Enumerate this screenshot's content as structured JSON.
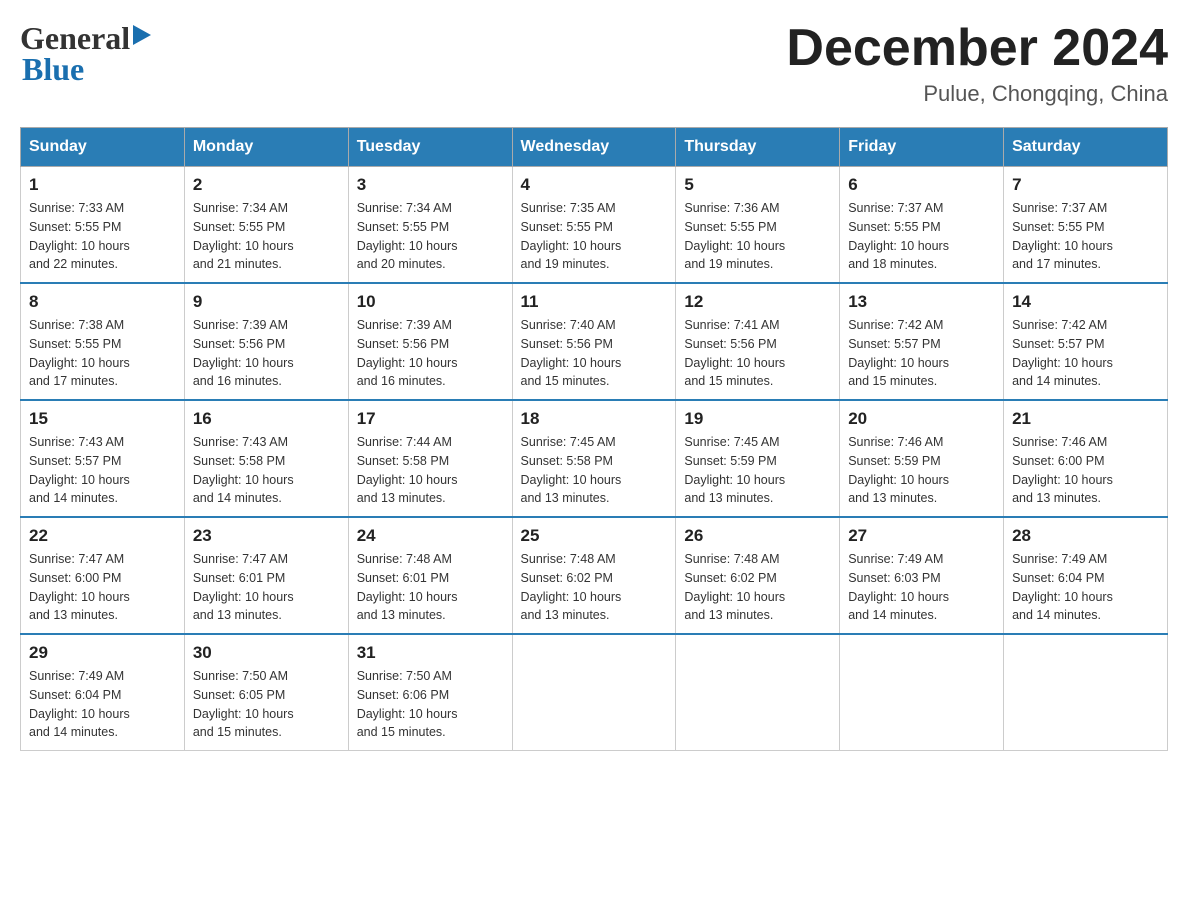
{
  "header": {
    "title": "December 2024",
    "subtitle": "Pulue, Chongqing, China",
    "logo_general": "General",
    "logo_blue": "Blue"
  },
  "days_of_week": [
    "Sunday",
    "Monday",
    "Tuesday",
    "Wednesday",
    "Thursday",
    "Friday",
    "Saturday"
  ],
  "weeks": [
    [
      {
        "day": "1",
        "sunrise": "7:33 AM",
        "sunset": "5:55 PM",
        "daylight": "10 hours and 22 minutes."
      },
      {
        "day": "2",
        "sunrise": "7:34 AM",
        "sunset": "5:55 PM",
        "daylight": "10 hours and 21 minutes."
      },
      {
        "day": "3",
        "sunrise": "7:34 AM",
        "sunset": "5:55 PM",
        "daylight": "10 hours and 20 minutes."
      },
      {
        "day": "4",
        "sunrise": "7:35 AM",
        "sunset": "5:55 PM",
        "daylight": "10 hours and 19 minutes."
      },
      {
        "day": "5",
        "sunrise": "7:36 AM",
        "sunset": "5:55 PM",
        "daylight": "10 hours and 19 minutes."
      },
      {
        "day": "6",
        "sunrise": "7:37 AM",
        "sunset": "5:55 PM",
        "daylight": "10 hours and 18 minutes."
      },
      {
        "day": "7",
        "sunrise": "7:37 AM",
        "sunset": "5:55 PM",
        "daylight": "10 hours and 17 minutes."
      }
    ],
    [
      {
        "day": "8",
        "sunrise": "7:38 AM",
        "sunset": "5:55 PM",
        "daylight": "10 hours and 17 minutes."
      },
      {
        "day": "9",
        "sunrise": "7:39 AM",
        "sunset": "5:56 PM",
        "daylight": "10 hours and 16 minutes."
      },
      {
        "day": "10",
        "sunrise": "7:39 AM",
        "sunset": "5:56 PM",
        "daylight": "10 hours and 16 minutes."
      },
      {
        "day": "11",
        "sunrise": "7:40 AM",
        "sunset": "5:56 PM",
        "daylight": "10 hours and 15 minutes."
      },
      {
        "day": "12",
        "sunrise": "7:41 AM",
        "sunset": "5:56 PM",
        "daylight": "10 hours and 15 minutes."
      },
      {
        "day": "13",
        "sunrise": "7:42 AM",
        "sunset": "5:57 PM",
        "daylight": "10 hours and 15 minutes."
      },
      {
        "day": "14",
        "sunrise": "7:42 AM",
        "sunset": "5:57 PM",
        "daylight": "10 hours and 14 minutes."
      }
    ],
    [
      {
        "day": "15",
        "sunrise": "7:43 AM",
        "sunset": "5:57 PM",
        "daylight": "10 hours and 14 minutes."
      },
      {
        "day": "16",
        "sunrise": "7:43 AM",
        "sunset": "5:58 PM",
        "daylight": "10 hours and 14 minutes."
      },
      {
        "day": "17",
        "sunrise": "7:44 AM",
        "sunset": "5:58 PM",
        "daylight": "10 hours and 13 minutes."
      },
      {
        "day": "18",
        "sunrise": "7:45 AM",
        "sunset": "5:58 PM",
        "daylight": "10 hours and 13 minutes."
      },
      {
        "day": "19",
        "sunrise": "7:45 AM",
        "sunset": "5:59 PM",
        "daylight": "10 hours and 13 minutes."
      },
      {
        "day": "20",
        "sunrise": "7:46 AM",
        "sunset": "5:59 PM",
        "daylight": "10 hours and 13 minutes."
      },
      {
        "day": "21",
        "sunrise": "7:46 AM",
        "sunset": "6:00 PM",
        "daylight": "10 hours and 13 minutes."
      }
    ],
    [
      {
        "day": "22",
        "sunrise": "7:47 AM",
        "sunset": "6:00 PM",
        "daylight": "10 hours and 13 minutes."
      },
      {
        "day": "23",
        "sunrise": "7:47 AM",
        "sunset": "6:01 PM",
        "daylight": "10 hours and 13 minutes."
      },
      {
        "day": "24",
        "sunrise": "7:48 AM",
        "sunset": "6:01 PM",
        "daylight": "10 hours and 13 minutes."
      },
      {
        "day": "25",
        "sunrise": "7:48 AM",
        "sunset": "6:02 PM",
        "daylight": "10 hours and 13 minutes."
      },
      {
        "day": "26",
        "sunrise": "7:48 AM",
        "sunset": "6:02 PM",
        "daylight": "10 hours and 13 minutes."
      },
      {
        "day": "27",
        "sunrise": "7:49 AM",
        "sunset": "6:03 PM",
        "daylight": "10 hours and 14 minutes."
      },
      {
        "day": "28",
        "sunrise": "7:49 AM",
        "sunset": "6:04 PM",
        "daylight": "10 hours and 14 minutes."
      }
    ],
    [
      {
        "day": "29",
        "sunrise": "7:49 AM",
        "sunset": "6:04 PM",
        "daylight": "10 hours and 14 minutes."
      },
      {
        "day": "30",
        "sunrise": "7:50 AM",
        "sunset": "6:05 PM",
        "daylight": "10 hours and 15 minutes."
      },
      {
        "day": "31",
        "sunrise": "7:50 AM",
        "sunset": "6:06 PM",
        "daylight": "10 hours and 15 minutes."
      },
      null,
      null,
      null,
      null
    ]
  ],
  "labels": {
    "sunrise": "Sunrise:",
    "sunset": "Sunset:",
    "daylight": "Daylight:"
  }
}
